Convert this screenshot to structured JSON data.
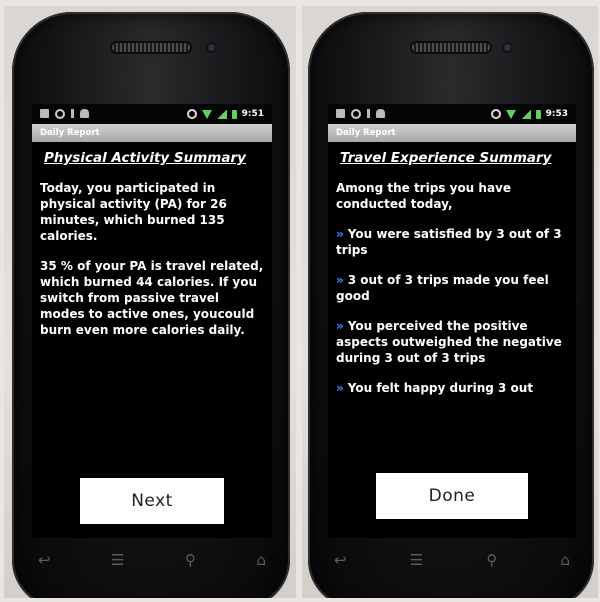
{
  "screens": [
    {
      "status_time": "9:51",
      "app_title": "Daily Report",
      "heading": "Physical Activity Summary",
      "paragraphs": [
        "Today, you participated in physical activity (PA) for 26 minutes, which burned 135 calories.",
        "35 % of your PA is travel related, which burned 44 calories. If you switch from passive travel modes to active ones, youcould burn even more calories daily."
      ],
      "button_label": "Next"
    },
    {
      "status_time": "9:53",
      "app_title": "Daily Report",
      "heading": "Travel Experience Summary",
      "intro": "Among the trips you have conducted today,",
      "bullet_glyph": "»",
      "bullets": [
        "You were satisfied by 3 out of 3 trips",
        "3 out of 3 trips made you feel good",
        "You perceived the positive aspects outweighed the negative during 3 out of 3 trips",
        "You felt happy during 3 out"
      ],
      "button_label": "Done"
    }
  ],
  "nav_icons": [
    "back-icon",
    "menu-icon",
    "search-icon",
    "home-icon"
  ],
  "colors": {
    "screen_bg": "#000000",
    "titlebar_bg": "#bdbdbd",
    "bullet_accent": "#3a8cff",
    "button_bg": "#ffffff"
  }
}
